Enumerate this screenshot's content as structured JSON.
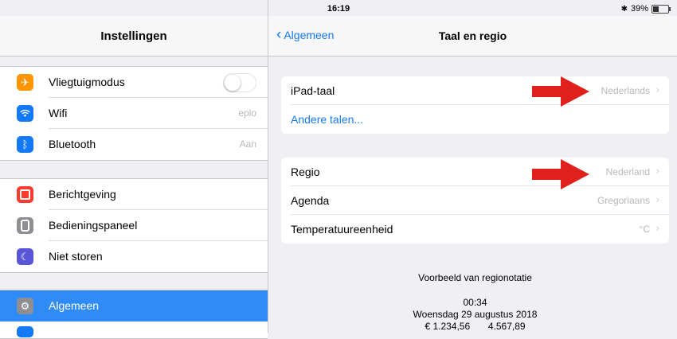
{
  "status": {
    "device": "iPad",
    "time": "16:19",
    "battery": "39%",
    "battery_level": 0.39
  },
  "left": {
    "title": "Instellingen",
    "group1": [
      {
        "label": "Vliegtuigmodus",
        "icon": "airplane-icon",
        "color": "#ff9500"
      },
      {
        "label": "Wifi",
        "value": "eplo",
        "icon": "wifi-icon",
        "color": "#1479f7"
      },
      {
        "label": "Bluetooth",
        "value": "Aan",
        "icon": "bluetooth-icon",
        "color": "#1479f7"
      }
    ],
    "group2": [
      {
        "label": "Berichtgeving",
        "icon": "notifications-icon",
        "color": "#ff3b30"
      },
      {
        "label": "Bedieningspaneel",
        "icon": "control-center-icon",
        "color": "#8e8e93"
      },
      {
        "label": "Niet storen",
        "icon": "moon-icon",
        "color": "#5856d6"
      }
    ],
    "group3": [
      {
        "label": "Algemeen",
        "icon": "gear-icon",
        "color": "#8e8e93",
        "selected": true
      }
    ]
  },
  "right": {
    "back_label": "Algemeen",
    "title": "Taal en regio",
    "lang_group": {
      "ipad_language_label": "iPad-taal",
      "ipad_language_value": "Nederlands",
      "other_languages_link": "Andere talen..."
    },
    "region_group": {
      "region_label": "Regio",
      "region_value": "Nederland",
      "calendar_label": "Agenda",
      "calendar_value": "Gregoriaans",
      "temperature_label": "Temperatuureenheid",
      "temperature_value": "°C"
    },
    "preview": {
      "heading": "Voorbeeld van regionotatie",
      "time": "00:34",
      "date": "Woensdag 29 augustus 2018",
      "currency": "€ 1.234,56",
      "number": "4.567,89"
    }
  },
  "colors": {
    "accent": "#1479f7",
    "selection": "#2f8bf5",
    "arrow": "#e0201c"
  }
}
